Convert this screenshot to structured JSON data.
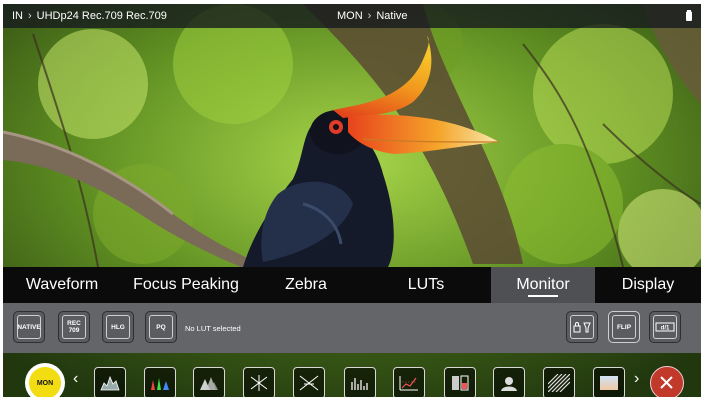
{
  "status_bar": {
    "input_prefix": "IN",
    "input_value": "UHDp24 Rec.709 Rec.709",
    "monitor_prefix": "MON",
    "monitor_value": "Native"
  },
  "tabs": [
    {
      "label": "Waveform",
      "active": false
    },
    {
      "label": "Focus Peaking",
      "active": false
    },
    {
      "label": "Zebra",
      "active": false
    },
    {
      "label": "LUTs",
      "active": false
    },
    {
      "label": "Monitor",
      "active": true
    },
    {
      "label": "Display",
      "active": false
    }
  ],
  "panel": {
    "native_label": "NATIVE",
    "rec709_label": "REC\n709",
    "hlg_label": "HLG",
    "pq_label": "PQ",
    "lut_status": "No LUT selected",
    "flip_label": "FLIP"
  },
  "toolbar": {
    "mon_label": "MON",
    "icons": [
      "luma-waveform-icon",
      "rgb-parade-icon",
      "rgb-overlay-icon",
      "vectorscope-icon",
      "vectorscope-zoom-icon",
      "histogram-icon",
      "false-color-icon",
      "split-compare-icon",
      "skin-tone-icon",
      "zebra-pattern-icon",
      "blend-gradient-icon"
    ]
  },
  "colors": {
    "accent_yellow": "#f2dd12",
    "close_red": "#c0392b",
    "panel_gray": "#636569",
    "tab_bar": "#0b0b0b"
  }
}
